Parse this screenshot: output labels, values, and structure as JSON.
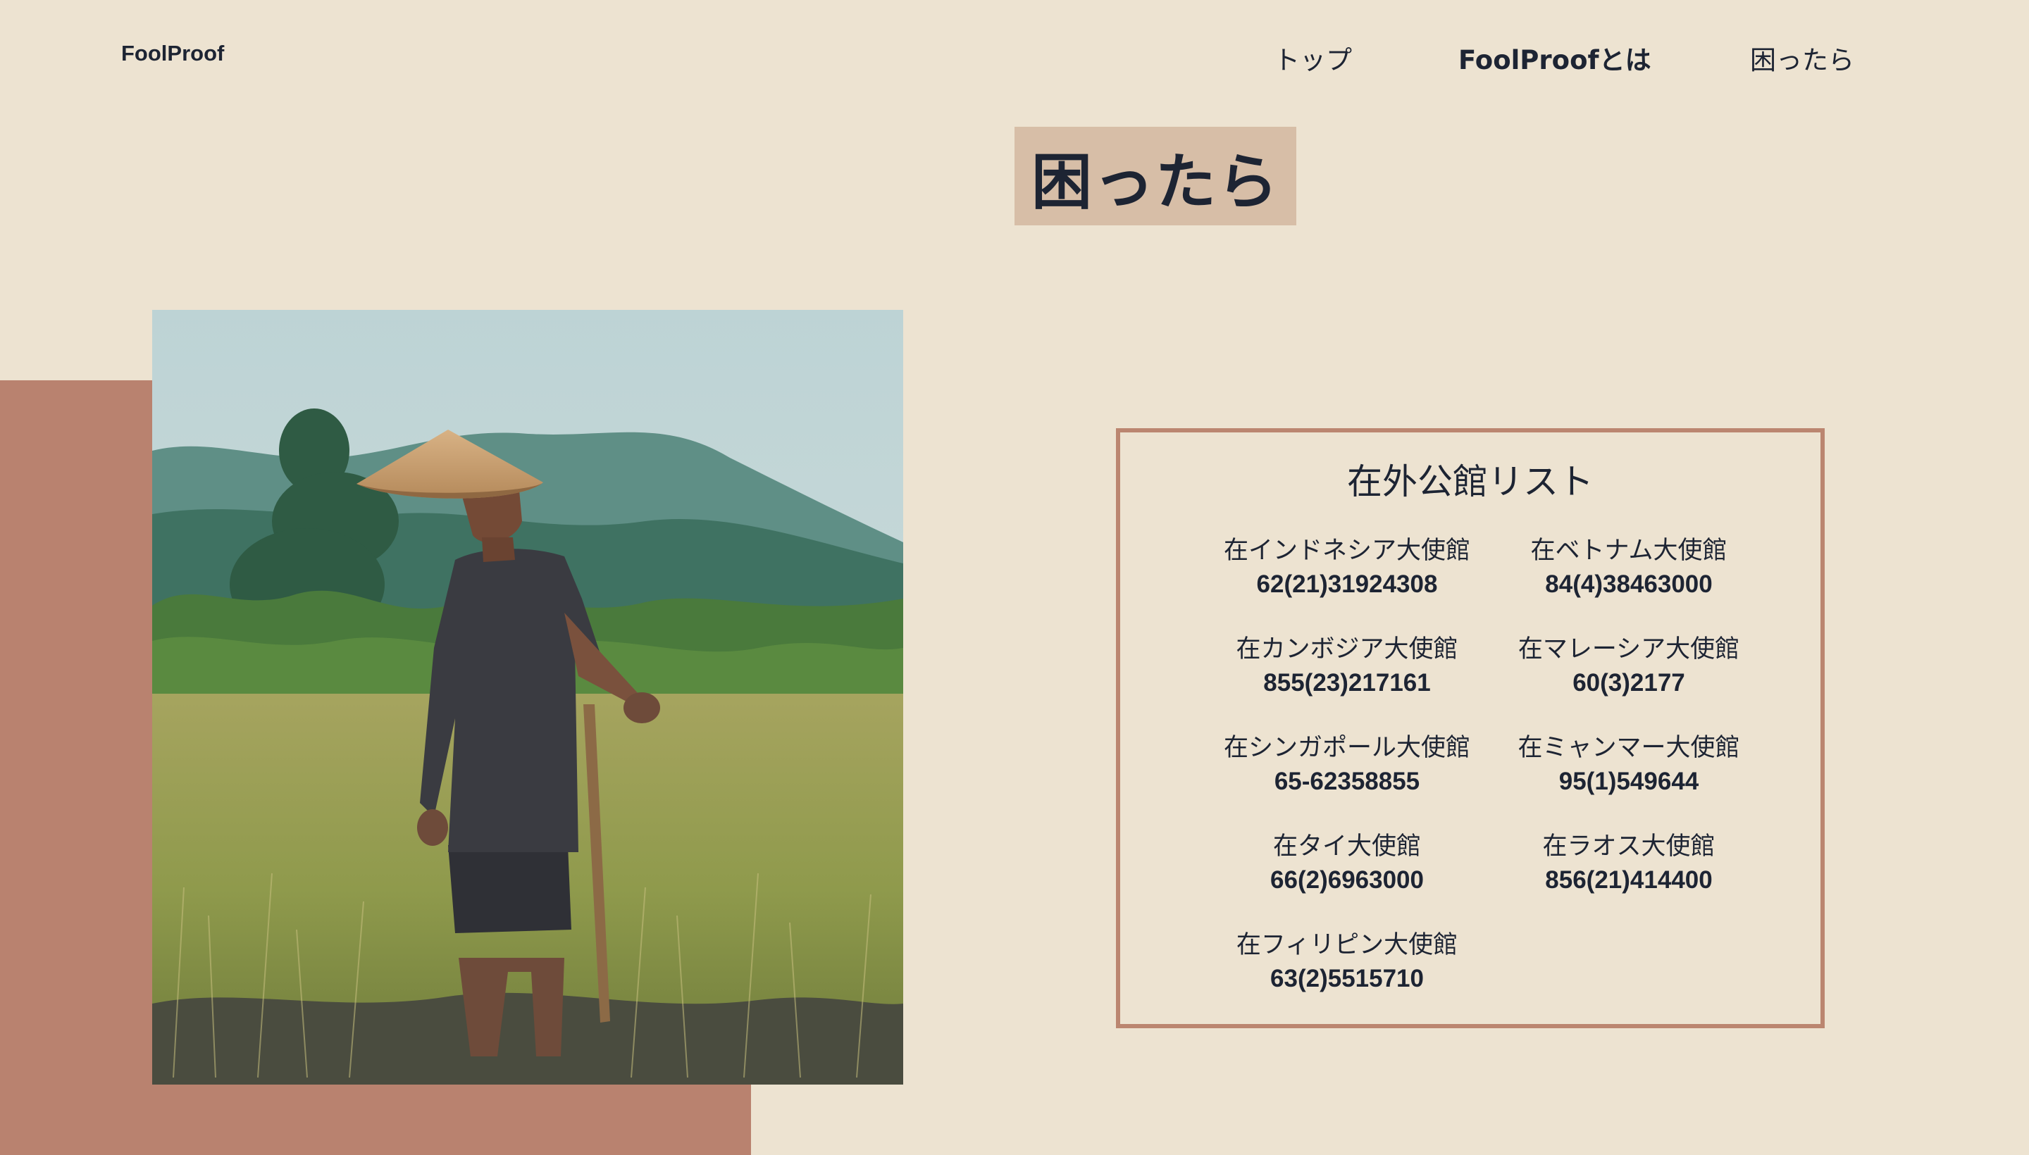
{
  "header": {
    "brand": "FoolProof",
    "nav": {
      "top": "トップ",
      "about": "FoolProofとは",
      "help": "困ったら"
    }
  },
  "page": {
    "title": "困ったら"
  },
  "colors": {
    "background": "#ede3d1",
    "title_box": "#d7bea7",
    "accent_block": "#b9826f",
    "box_border": "#bb8670",
    "text": "#1d2433"
  },
  "embassies": {
    "title": "在外公館リスト",
    "items": [
      {
        "name": "在インドネシア大使館",
        "phone": "62(21)31924308"
      },
      {
        "name": "在ベトナム大使館",
        "phone": "84(4)38463000"
      },
      {
        "name": "在カンボジア大使館",
        "phone": "855(23)217161"
      },
      {
        "name": "在マレーシア大使館",
        "phone": "60(3)2177"
      },
      {
        "name": "在シンガポール大使館",
        "phone": "65-62358855"
      },
      {
        "name": "在ミャンマー大使館",
        "phone": "95(1)549644"
      },
      {
        "name": "在タイ大使館",
        "phone": "66(2)6963000"
      },
      {
        "name": "在ラオス大使館",
        "phone": "856(21)414400"
      },
      {
        "name": "在フィリピン大使館",
        "phone": "63(2)5515710"
      }
    ]
  }
}
